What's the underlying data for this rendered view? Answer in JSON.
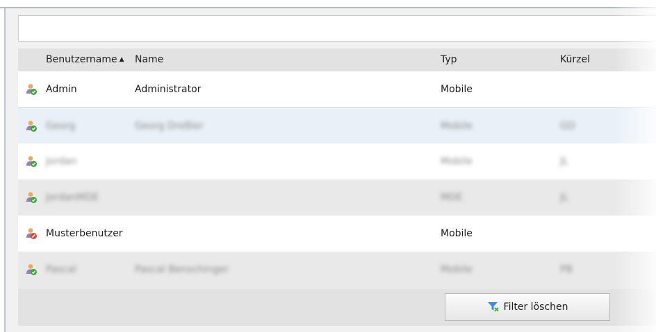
{
  "search": {
    "value": "",
    "placeholder": ""
  },
  "table": {
    "columns": [
      {
        "label": "Benutzername",
        "sort": "ascending"
      },
      {
        "label": "Name"
      },
      {
        "label": "Typ"
      },
      {
        "label": "Kürzel"
      }
    ],
    "rows": [
      {
        "status": "active",
        "username": "Admin",
        "name": "Administrator",
        "type": "Mobile",
        "short": ""
      },
      {
        "status": "active",
        "username": "Georg",
        "name": "Georg Dreßler",
        "type": "Mobile",
        "short": "GD"
      },
      {
        "status": "active",
        "username": "Jordan",
        "name": "",
        "type": "Mobile",
        "short": "JL"
      },
      {
        "status": "active",
        "username": "JordanMDE",
        "name": "",
        "type": "MDE",
        "short": "JL"
      },
      {
        "status": "inactive",
        "username": "Musterbenutzer",
        "name": "",
        "type": "Mobile",
        "short": ""
      },
      {
        "status": "active",
        "username": "Pascal",
        "name": "Pascal Benschinger",
        "type": "Mobile",
        "short": "PB"
      }
    ]
  },
  "footer": {
    "clear_filter_label": "Filter löschen"
  },
  "icons": {
    "user_active": "user-check-icon",
    "user_inactive": "user-blocked-icon",
    "filter_clear": "filter-clear-icon"
  },
  "colors": {
    "header_bg": "#e2e2e2",
    "row_alt_bg": "#e9e9e9",
    "row_selected_bg": "#e9f0f8",
    "status_active": "#3aa635",
    "status_inactive": "#e0452b"
  }
}
